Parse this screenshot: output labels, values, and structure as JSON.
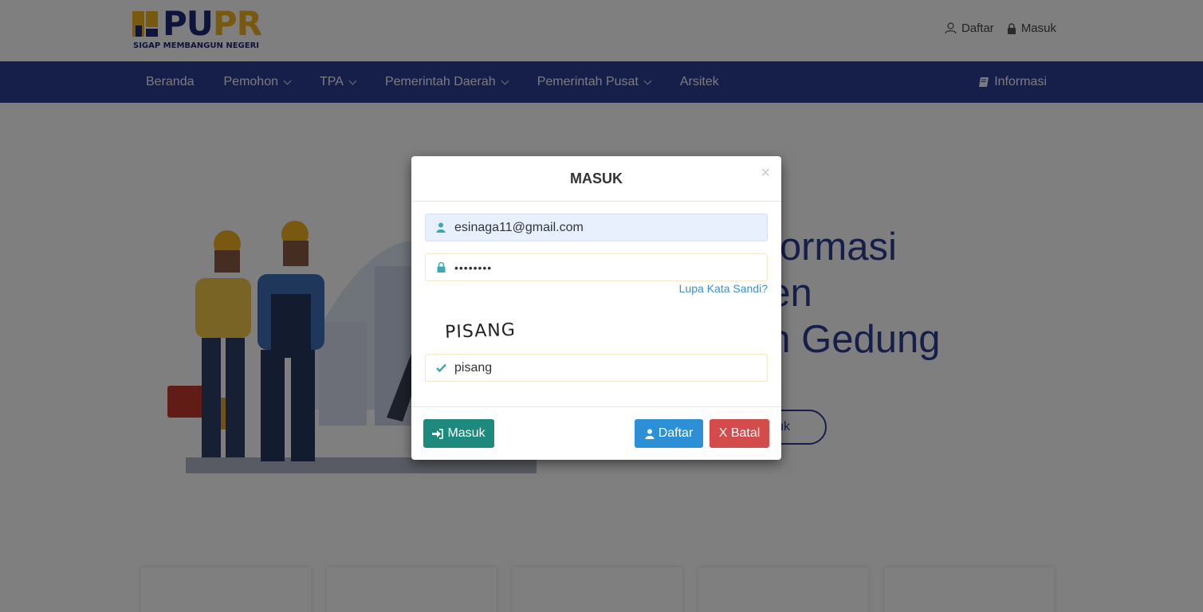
{
  "header": {
    "logo_text_a": "PU",
    "logo_text_b": "PR",
    "logo_tagline": "SIGAP MEMBANGUN NEGERI",
    "top_links": [
      {
        "label": "Daftar",
        "icon": "user-icon"
      },
      {
        "label": "Masuk",
        "icon": "lock-icon"
      }
    ]
  },
  "nav": {
    "items": [
      {
        "label": "Beranda",
        "dropdown": false
      },
      {
        "label": "Pemohon",
        "dropdown": true
      },
      {
        "label": "TPA",
        "dropdown": true
      },
      {
        "label": "Pemerintah Daerah",
        "dropdown": true
      },
      {
        "label": "Pemerintah Pusat",
        "dropdown": true
      },
      {
        "label": "Arsitek",
        "dropdown": false
      }
    ],
    "info_label": "Informasi",
    "info_icon": "book-icon"
  },
  "hero": {
    "title_visible": "nformasi\nnen\nan Gedung",
    "button_visible": "suk"
  },
  "modal": {
    "title": "MASUK",
    "close": "×",
    "email_value": "esinaga11@gmail.com",
    "password_dots": "••••••••",
    "forgot_label": "Lupa Kata Sandi?",
    "captcha_text": "PISANG",
    "captcha_value": "pisang",
    "btn_masuk": "Masuk",
    "btn_daftar": "Daftar",
    "btn_batal": "X Batal"
  },
  "colors": {
    "navbar": "#2c3e94",
    "btn_masuk": "#1e8a7d",
    "btn_daftar": "#2d8fd6",
    "btn_batal": "#d44b4b",
    "logo_yellow": "#f2b01e",
    "logo_blue": "#1b2a7a"
  }
}
